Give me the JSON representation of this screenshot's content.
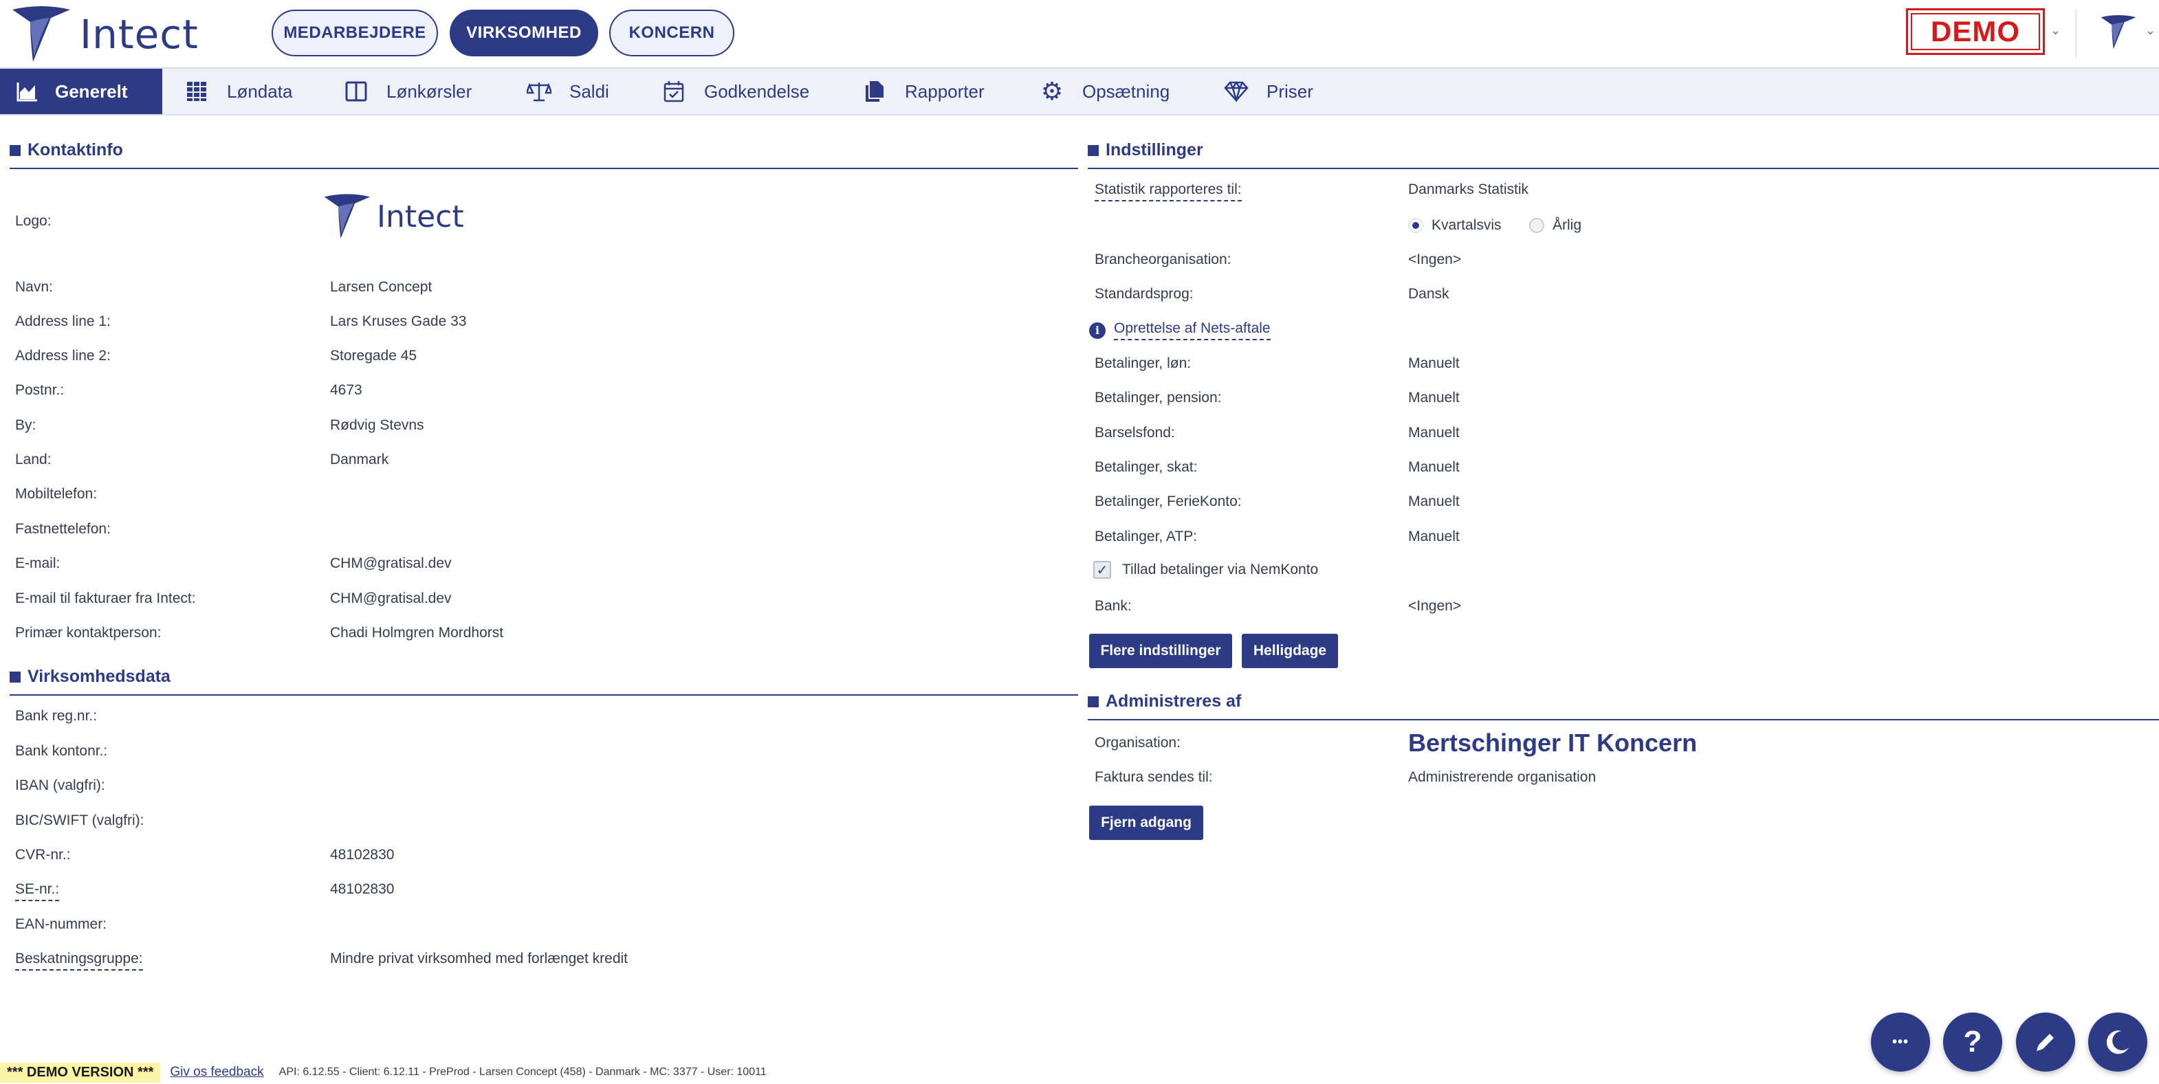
{
  "header": {
    "brand": "Intect",
    "scopes": [
      "MEDARBEJDERE",
      "VIRKSOMHED",
      "KONCERN"
    ],
    "active_scope": "VIRKSOMHED",
    "demo_badge": "DEMO"
  },
  "nav": {
    "items": [
      {
        "label": "Generelt",
        "icon": "chart-area-icon"
      },
      {
        "label": "Løndata",
        "icon": "table-grid-icon"
      },
      {
        "label": "Lønkørsler",
        "icon": "columns-icon"
      },
      {
        "label": "Saldi",
        "icon": "balance-scale-icon"
      },
      {
        "label": "Godkendelse",
        "icon": "calendar-check-icon"
      },
      {
        "label": "Rapporter",
        "icon": "documents-icon"
      },
      {
        "label": "Opsætning",
        "icon": "gear-icon"
      },
      {
        "label": "Priser",
        "icon": "diamond-icon"
      }
    ],
    "active": "Generelt"
  },
  "contact": {
    "title": "Kontaktinfo",
    "logo_label": "Logo:",
    "logo_brand": "Intect",
    "rows": [
      {
        "label": "Navn:",
        "value": "Larsen Concept"
      },
      {
        "label": "Address line 1:",
        "value": "Lars Kruses Gade 33"
      },
      {
        "label": "Address line 2:",
        "value": "Storegade 45"
      },
      {
        "label": "Postnr.:",
        "value": "4673"
      },
      {
        "label": "By:",
        "value": "Rødvig Stevns"
      },
      {
        "label": "Land:",
        "value": "Danmark"
      },
      {
        "label": "Mobiltelefon:",
        "value": ""
      },
      {
        "label": "Fastnettelefon:",
        "value": ""
      },
      {
        "label": "E-mail:",
        "value": "CHM@gratisal.dev"
      },
      {
        "label": "E-mail til fakturaer fra Intect:",
        "value": "CHM@gratisal.dev"
      },
      {
        "label": "Primær kontaktperson:",
        "value": "Chadi Holmgren Mordhorst"
      }
    ]
  },
  "company": {
    "title": "Virksomhedsdata",
    "rows": [
      {
        "label": "Bank reg.nr.:",
        "value": ""
      },
      {
        "label": "Bank kontonr.:",
        "value": ""
      },
      {
        "label": "IBAN (valgfri):",
        "value": ""
      },
      {
        "label": "BIC/SWIFT (valgfri):",
        "value": ""
      },
      {
        "label": "CVR-nr.:",
        "value": "48102830"
      },
      {
        "label": "SE-nr.:",
        "value": "48102830"
      },
      {
        "label": "EAN-nummer:",
        "value": ""
      },
      {
        "label": "Beskatningsgruppe:",
        "value": "Mindre privat virksomhed med forlænget kredit"
      }
    ]
  },
  "settings": {
    "title": "Indstillinger",
    "statistics_label": "Statistik rapporteres til:",
    "statistics_value": "Danmarks Statistik",
    "radio_quarterly": "Kvartalsvis",
    "radio_yearly": "Årlig",
    "selected_period": "Kvartalsvis",
    "branch_label": "Brancheorganisation:",
    "branch_value": "<Ingen>",
    "language_label": "Standardsprog:",
    "language_value": "Dansk",
    "nets_link": "Oprettelse af Nets-aftale",
    "payments": [
      {
        "label": "Betalinger, løn:",
        "value": "Manuelt"
      },
      {
        "label": "Betalinger, pension:",
        "value": "Manuelt"
      },
      {
        "label": "Barselsfond:",
        "value": "Manuelt"
      },
      {
        "label": "Betalinger, skat:",
        "value": "Manuelt"
      },
      {
        "label": "Betalinger, FerieKonto:",
        "value": "Manuelt"
      },
      {
        "label": "Betalinger, ATP:",
        "value": "Manuelt"
      }
    ],
    "nemkonto_label": "Tillad betalinger via NemKonto",
    "nemkonto_checked": true,
    "bank_label": "Bank:",
    "bank_value": "<Ingen>",
    "more_button": "Flere indstillinger",
    "holidays_button": "Helligdage"
  },
  "admin": {
    "title": "Administreres af",
    "org_label": "Organisation:",
    "org_value": "Bertschinger IT Koncern",
    "invoice_label": "Faktura sendes til:",
    "invoice_value": "Administrerende organisation",
    "remove_button": "Fjern adgang"
  },
  "footer": {
    "demo_version": "*** DEMO VERSION ***",
    "feedback": "Giv os feedback",
    "api_info": "API: 6.12.55 - Client: 6.12.11 - PreProd  - Larsen Concept (458) - Danmark - MC: 3377  - User: 10011"
  },
  "fabs": {
    "more": "•••",
    "help": "?"
  },
  "colors": {
    "brand": "#2d3a85",
    "nav_bg": "#eef1f8",
    "demo_red": "#d41a1a",
    "demo_yellow": "#fbf3a6"
  }
}
